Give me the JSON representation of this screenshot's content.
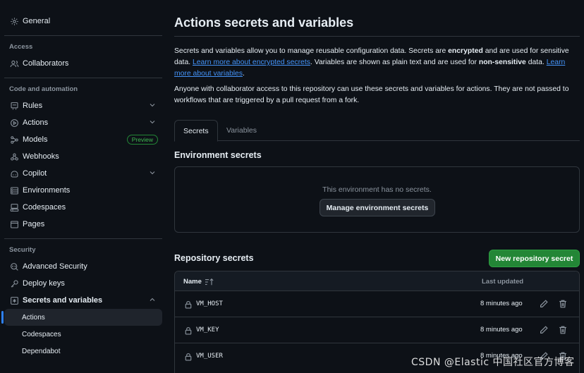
{
  "sidebar": {
    "general": "General",
    "access_heading": "Access",
    "collaborators": "Collaborators",
    "code_heading": "Code and automation",
    "rules": "Rules",
    "actions": "Actions",
    "models": "Models",
    "models_badge": "Preview",
    "webhooks": "Webhooks",
    "copilot": "Copilot",
    "environments": "Environments",
    "codespaces": "Codespaces",
    "pages": "Pages",
    "security_heading": "Security",
    "advanced_security": "Advanced Security",
    "deploy_keys": "Deploy keys",
    "secrets_and_variables": "Secrets and variables",
    "sub_items": [
      "Actions",
      "Codespaces",
      "Dependabot"
    ],
    "active_sub_item": "Actions"
  },
  "main": {
    "title": "Actions secrets and variables",
    "intro": {
      "t1": "Secrets and variables allow you to manage reusable configuration data. Secrets are ",
      "b1": "encrypted",
      "t2": " and are used for sensitive data. ",
      "link1": "Learn more about encrypted secrets",
      "t3": ". Variables are shown as plain text and are used for ",
      "b2": "non-sensitive",
      "t4": " data. ",
      "link2": "Learn more about variables",
      "t5": "."
    },
    "access_note": "Anyone with collaborator access to this repository can use these secrets and variables for actions. They are not passed to workflows that are triggered by a pull request from a fork.",
    "tabs": [
      "Secrets",
      "Variables"
    ],
    "active_tab": "Secrets",
    "environment_secrets": {
      "title": "Environment secrets",
      "empty_text": "This environment has no secrets.",
      "manage_button": "Manage environment secrets"
    },
    "repository_secrets": {
      "title": "Repository secrets",
      "new_button": "New repository secret",
      "columns": {
        "name": "Name",
        "last_updated": "Last updated"
      },
      "rows": [
        {
          "name": "VM_HOST",
          "updated": "8 minutes ago"
        },
        {
          "name": "VM_KEY",
          "updated": "8 minutes ago"
        },
        {
          "name": "VM_USER",
          "updated": "8 minutes ago"
        }
      ]
    }
  },
  "watermark": "CSDN @Elastic 中国社区官方博客",
  "colors": {
    "background": "#0d1117",
    "border": "#30363d",
    "link": "#4493f8",
    "primary_button": "#238636",
    "active_indicator": "#2f81f7",
    "muted_text": "#8b949e"
  }
}
